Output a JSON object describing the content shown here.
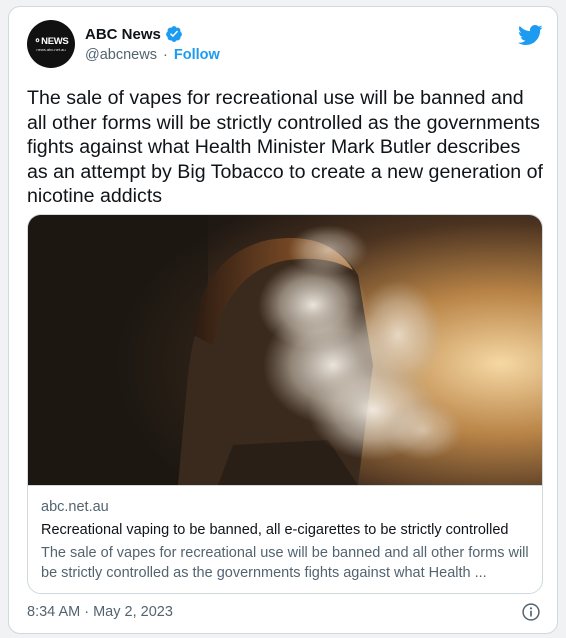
{
  "author": {
    "name": "ABC News",
    "handle": "@abcnews",
    "separator": "·",
    "follow_label": "Follow",
    "avatar_text": "NEWS",
    "avatar_subtext": "news.abc.net.au"
  },
  "tweet": {
    "text": "The sale of vapes for recreational use will be banned and all other forms will be strictly controlled as the governments fights against what Health Minister Mark Butler describes as an attempt by Big Tobacco to create a new generation of nicotine addicts",
    "timestamp": "8:34 AM · May 2, 2023"
  },
  "link_card": {
    "domain": "abc.net.au",
    "title": "Recreational vaping to be banned, all e-cigarettes to be strictly controlled",
    "description": "The sale of vapes for recreational use will be banned and all other forms will be strictly controlled as the governments fights against what Health ..."
  },
  "colors": {
    "accent": "#1d9bf0",
    "text_primary": "#0f1419",
    "text_secondary": "#536471",
    "border": "#cfd9de"
  },
  "icons": {
    "verified": "verified-badge-icon",
    "brand": "twitter-bird-icon",
    "info": "info-circle-icon"
  }
}
